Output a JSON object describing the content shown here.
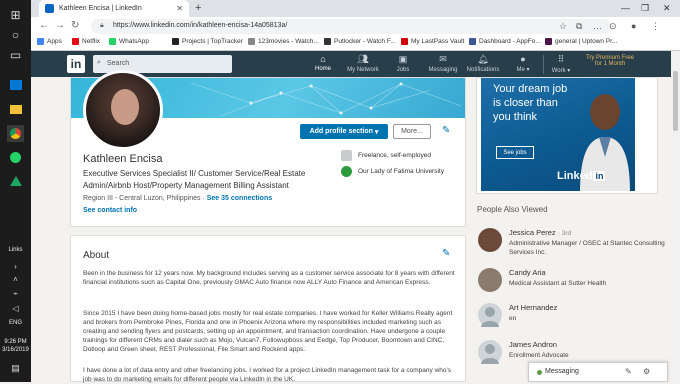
{
  "browser": {
    "tab_title": "Kathleen Encisa | LinkedIn",
    "url": "https://www.linkedin.com/in/kathleen-encisa-14a05813a/",
    "bookmarks": [
      "Apps",
      "Netflix",
      "WhatsApp",
      "Projects | TopTracker",
      "123movies - Watch...",
      "Putlocker - Watch F...",
      "My LastPass Vault",
      "Dashboard - AppFo...",
      "general | Uptown Pr..."
    ],
    "bookmark_colors": [
      "#4285f4",
      "#e50914",
      "#25d366",
      "#222222",
      "#888888",
      "#333333",
      "#cc0000",
      "#3b5998",
      "#4a154b"
    ]
  },
  "taskbar": {
    "links_label": "Links",
    "lang": "ENG",
    "time": "9:26 PM",
    "date": "3/16/2019"
  },
  "linkedin_nav": {
    "search_placeholder": "Search",
    "items": [
      {
        "label": "Home",
        "icon": "home-icon"
      },
      {
        "label": "My Network",
        "icon": "people-icon"
      },
      {
        "label": "Jobs",
        "icon": "briefcase-icon"
      },
      {
        "label": "Messaging",
        "icon": "chat-icon"
      },
      {
        "label": "Notifications",
        "icon": "bell-icon"
      },
      {
        "label": "Me",
        "icon": "avatar-icon"
      },
      {
        "label": "Work",
        "icon": "grid-icon"
      }
    ],
    "premium_line1": "Try Premium Free",
    "premium_line2": "for 1 Month"
  },
  "profile": {
    "add_section_label": "Add profile section",
    "more_label": "More...",
    "name": "Kathleen Encisa",
    "headline": "Executive Services Specialist II/ Customer Service/Real Estate Admin/Airbnb Host/Property Management Billing Assistant",
    "location": "Region III - Central Luzon, Philippines",
    "connections": "See 35 connections",
    "contact": "See contact info",
    "company": "Freelance, self-employed",
    "school": "Our Lady of Fatima University"
  },
  "about": {
    "title": "About",
    "p1": "Been in the business for 12 years now. My background includes serving as a customer service associate for 8 years with different financial institutions such as Capital One, previously GMAC Auto finance now ALLY Auto Finance and American Express.",
    "p2": "Since 2015 I have been doing home-based jobs mostly for real estate companies. I have worked for Keller Williams Realty agent and brokers from Pembroke Pines, Florida and one in Phoenix Arizona where my responsibilities included marketing such as creating and sending flyers and postcards, setting up an appointment, and transaction coordination. Have undergone a couple trainings for different CRMs and dialer such as Mojo, Vulcan7, Followupboss and Eedge, Top Producer, Boomtown and CINC, Dotloop and Green sheet, REST Professional, File Smart and Rockend apps.",
    "p3": "I have done a lot of data entry and other freelancing jobs. I worked for a project LinkedIn management task for a company who's job was to do marketing emails for different people via LinkedIn in the UK."
  },
  "ad": {
    "headline": "Your dream job is closer than you think",
    "button": "See jobs",
    "brand": "Linked",
    "brand_in": "in"
  },
  "people_also_viewed": {
    "title": "People Also Viewed",
    "people": [
      {
        "name": "Jessica Perez",
        "degree": "· 3rd",
        "title": "Administrative Manager / OSEC at Stantec Consulting Services Inc.",
        "color": "#6b4a3a"
      },
      {
        "name": "Candy Aria",
        "degree": "",
        "title": "Medical Assistant at Sutter Health",
        "color": "#8a7b6e"
      },
      {
        "name": "Art Hernandez",
        "degree": "",
        "title": "en",
        "color": "#cfd4d8"
      },
      {
        "name": "James Andron",
        "degree": "",
        "title": "Enrollment Advocate",
        "color": "#cfd4d8"
      }
    ]
  },
  "messaging": {
    "label": "Messaging"
  }
}
